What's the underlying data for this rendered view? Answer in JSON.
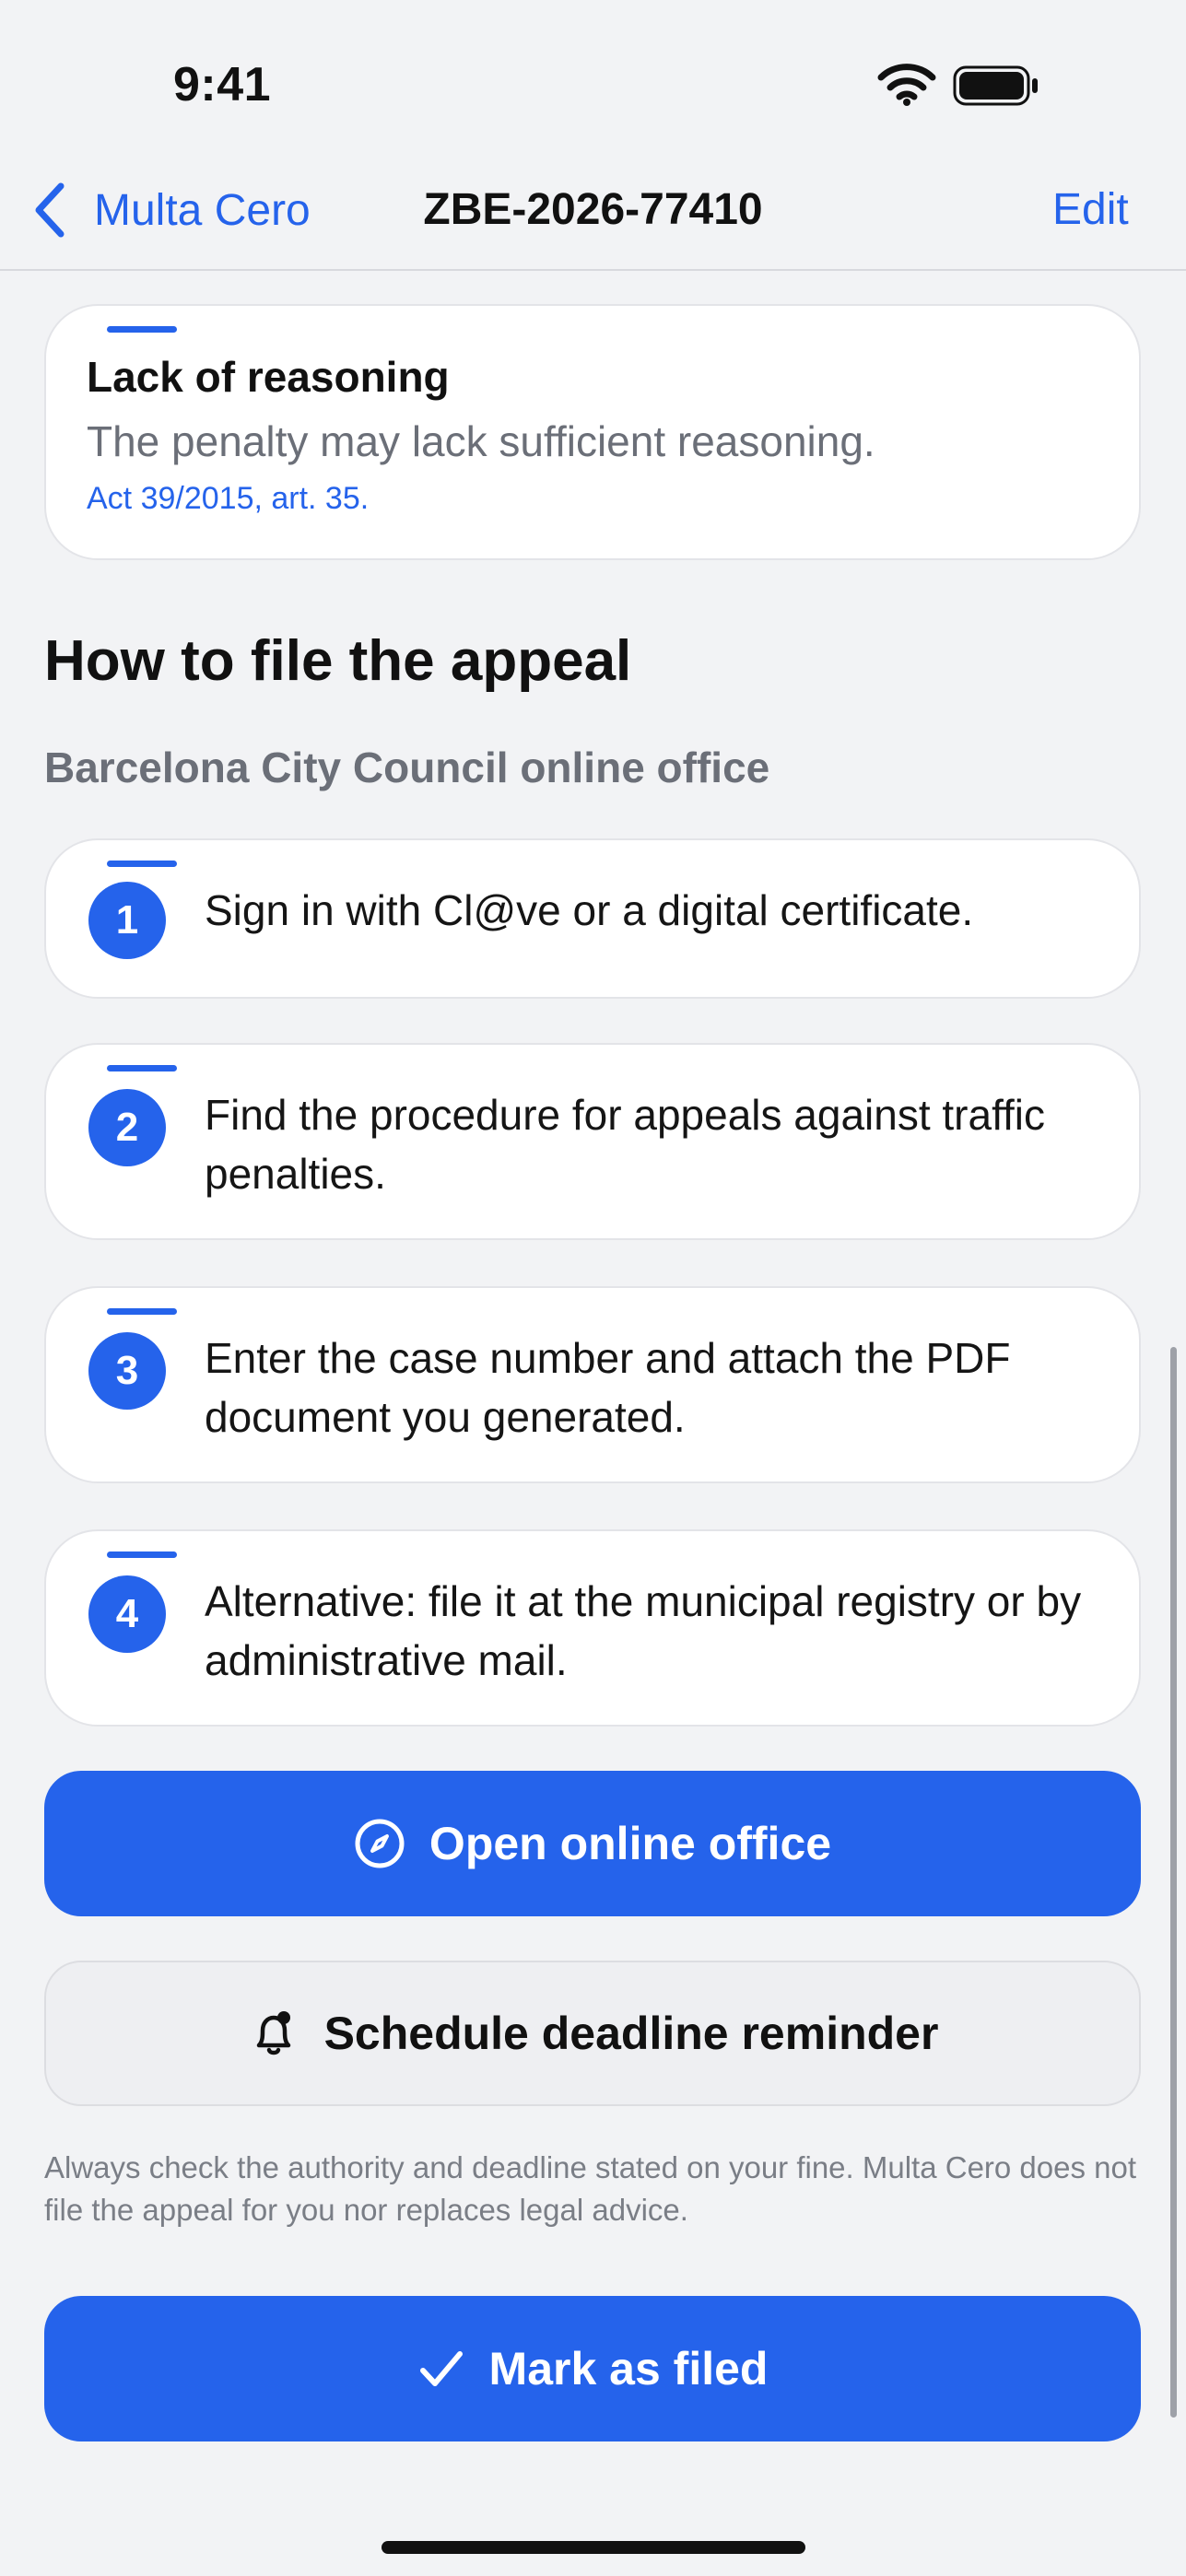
{
  "status_bar": {
    "time": "9:41"
  },
  "nav": {
    "back_label": "Multa Cero",
    "title": "ZBE-2026-77410",
    "edit_label": "Edit"
  },
  "reason_card": {
    "title": "Lack of reasoning",
    "description": "The penalty may lack sufficient reasoning.",
    "reference": "Act 39/2015, art. 35."
  },
  "appeal": {
    "heading": "How to file the appeal",
    "subheading": "Barcelona City Council online office",
    "steps": [
      {
        "number": "1",
        "text": "Sign in with Cl@ve or a digital certificate."
      },
      {
        "number": "2",
        "text": "Find the procedure for appeals against traffic penalties."
      },
      {
        "number": "3",
        "text": "Enter the case number and attach the PDF document you generated."
      },
      {
        "number": "4",
        "text": "Alternative: file it at the municipal registry or by administrative mail."
      }
    ]
  },
  "buttons": {
    "open_office": "Open online office",
    "schedule_reminder": "Schedule deadline reminder",
    "mark_filed": "Mark as filed"
  },
  "disclaimer": "Always check the authority and deadline stated on your fine. Multa Cero does not file the appeal for you nor replaces legal advice.",
  "colors": {
    "accent": "#2563eb",
    "background": "#f2f3f5",
    "card": "#ffffff"
  },
  "icons": {
    "back": "chevron-left-icon",
    "open_office": "compass-icon",
    "reminder": "bell-badge-icon",
    "mark_filed": "checkmark-icon"
  }
}
